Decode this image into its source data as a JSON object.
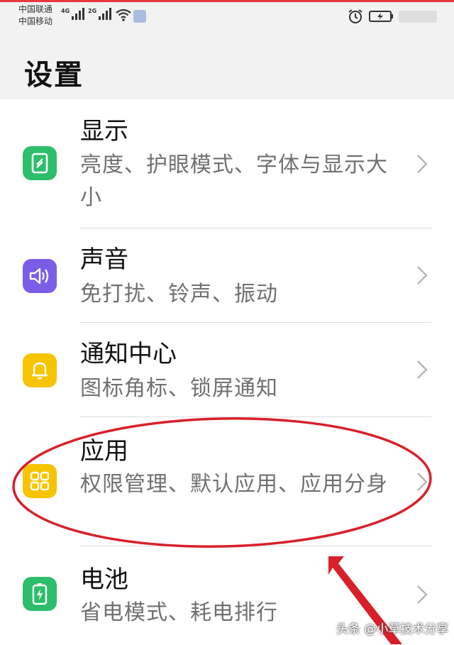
{
  "status_bar": {
    "carrier_1": "中国联通",
    "carrier_2": "中国移动",
    "network_1": "4G",
    "network_2": "2G",
    "accent_color": "#e8383d"
  },
  "header": {
    "title": "设置"
  },
  "settings": {
    "items": [
      {
        "title": "显示",
        "subtitle": "亮度、护眼模式、字体与显示大小",
        "icon": "display-icon",
        "color": "#2dbe6c"
      },
      {
        "title": "声音",
        "subtitle": "免打扰、铃声、振动",
        "icon": "sound-icon",
        "color": "#7b5de8"
      },
      {
        "title": "通知中心",
        "subtitle": "图标角标、锁屏通知",
        "icon": "bell-icon",
        "color": "#f6c400"
      },
      {
        "title": "应用",
        "subtitle": "权限管理、默认应用、应用分身",
        "icon": "apps-grid-icon",
        "color": "#f6c400"
      },
      {
        "title": "电池",
        "subtitle": "省电模式、耗电排行",
        "icon": "battery-icon",
        "color": "#2dbe6c"
      }
    ]
  },
  "watermark": {
    "text": "头条 @小草技术分享"
  },
  "annotation_color": "#d8202a"
}
